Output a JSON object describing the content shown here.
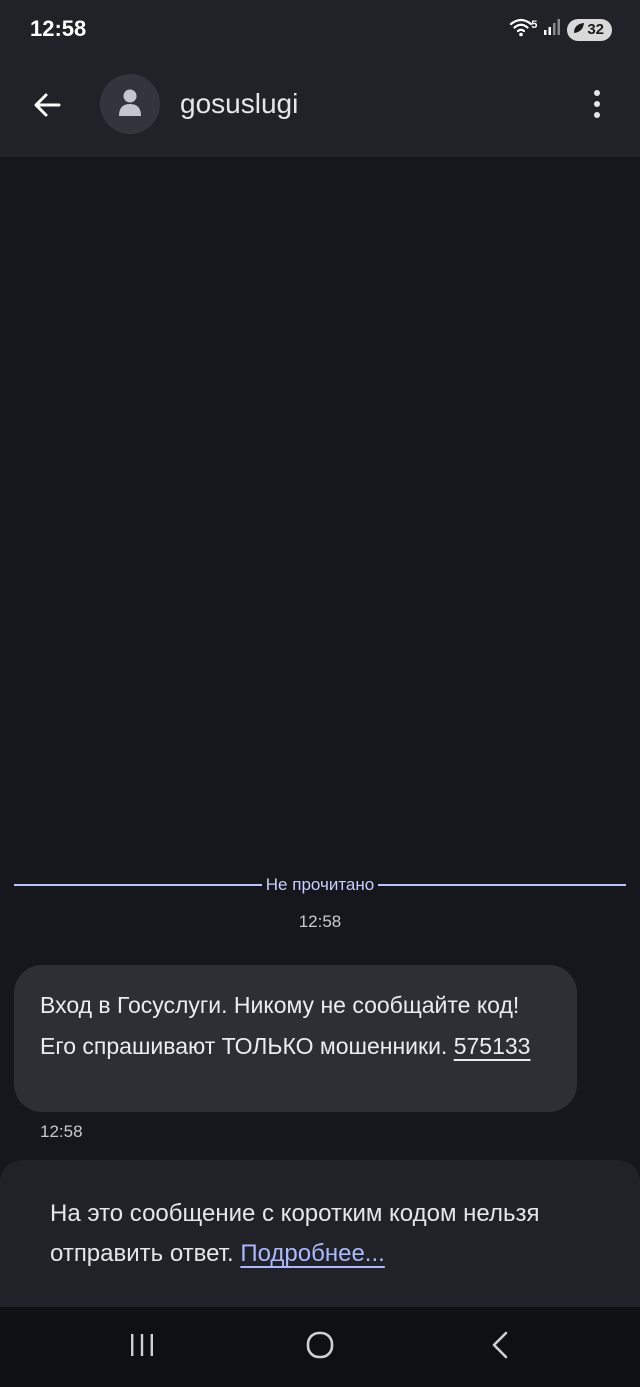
{
  "status": {
    "time": "12:58",
    "network": "5",
    "battery": "32"
  },
  "header": {
    "title": "gosuslugi"
  },
  "chat": {
    "unread_label": "Не прочитано",
    "divider_time": "12:58",
    "messages": [
      {
        "text": "Вход в Госуслуги. Никому не сообщайте код! Его спрашивают ТОЛЬКО мошенники. ",
        "code": "575133",
        "time": "12:58"
      }
    ]
  },
  "footer": {
    "text": "На это сообщение с коротким кодом нельзя отправить ответ. ",
    "link": "Подробнее..."
  },
  "icons": {
    "back": "arrow-left-icon",
    "avatar": "person-icon",
    "more": "more-vertical-icon",
    "recents": "recents-icon",
    "home": "home-icon",
    "nav_back": "chevron-left-icon"
  },
  "colors": {
    "background": "#16171c",
    "bar": "#212227",
    "bubble": "#2d2f35",
    "accent": "#b8c4ff"
  }
}
